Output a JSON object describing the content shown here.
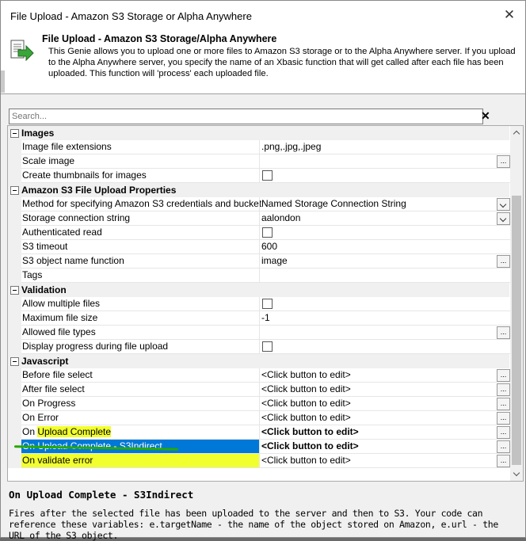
{
  "window": {
    "title": "File Upload - Amazon S3 Storage or Alpha Anywhere",
    "close_glyph": "✕"
  },
  "header": {
    "title": "File Upload - Amazon S3 Storage/Alpha Anywhere",
    "description": "This Genie allows you to upload one or more files to Amazon S3 storage or to the Alpha Anywhere server. If you upload to the Alpha Anywhere server, you specify the name of an Xbasic function that will get called after each file has been uploaded. This function will 'process' each uploaded file.",
    "icon": "upload-arrow-icon"
  },
  "search": {
    "placeholder": "Search...",
    "clear_glyph": "✕"
  },
  "categories": {
    "images": "Images",
    "s3": "Amazon S3 File Upload Properties",
    "validation": "Validation",
    "javascript": "Javascript"
  },
  "props": {
    "image_ext": {
      "name": "Image file extensions",
      "value": ".png,.jpg,.jpeg"
    },
    "scale_image": {
      "name": "Scale image",
      "value": ""
    },
    "thumbnails": {
      "name": "Create thumbnails for images"
    },
    "method": {
      "name": "Method for specifying Amazon S3 credentials and bucket",
      "value": "Named Storage Connection String"
    },
    "conn_string": {
      "name": "Storage connection string",
      "value": "aalondon"
    },
    "auth_read": {
      "name": "Authenticated read"
    },
    "timeout": {
      "name": "S3 timeout",
      "value": "600"
    },
    "obj_name_fn": {
      "name": "S3 object name function",
      "value": "image"
    },
    "tags": {
      "name": "Tags",
      "value": ""
    },
    "allow_multiple": {
      "name": "Allow multiple files"
    },
    "max_size": {
      "name": "Maximum file size",
      "value": "-1"
    },
    "allowed_types": {
      "name": "Allowed file types",
      "value": ""
    },
    "display_progress": {
      "name": "Display progress during file upload"
    },
    "before_select": {
      "name": "Before file select",
      "value": "<Click button to edit>"
    },
    "after_select": {
      "name": "After file select",
      "value": "<Click button to edit>"
    },
    "on_progress": {
      "name": "On Progress",
      "value": "<Click button to edit>"
    },
    "on_error": {
      "name": "On Error",
      "value": "<Click button to edit>"
    },
    "on_upload_complete": {
      "name_a": "On ",
      "name_b": "Upload Complete",
      "value": "<Click button to edit>"
    },
    "on_upload_complete_s3": {
      "name": "On Upload Complete - S3Indirect",
      "value": "<Click button to edit>"
    },
    "on_validate_error": {
      "name": "On validate error",
      "value": "<Click button to edit>"
    }
  },
  "ellipsis": "...",
  "description_panel": {
    "title": "On Upload Complete - S3Indirect",
    "text": "Fires after the selected file has been uploaded to the server and then to S3. Your code can reference these variables: e.targetName - the name of the object stored on Amazon, e.url - the URL of the S3 object."
  },
  "colors": {
    "selection": "#0078d7",
    "highlight": "#f2ff2e",
    "annotation": "#28a800"
  }
}
